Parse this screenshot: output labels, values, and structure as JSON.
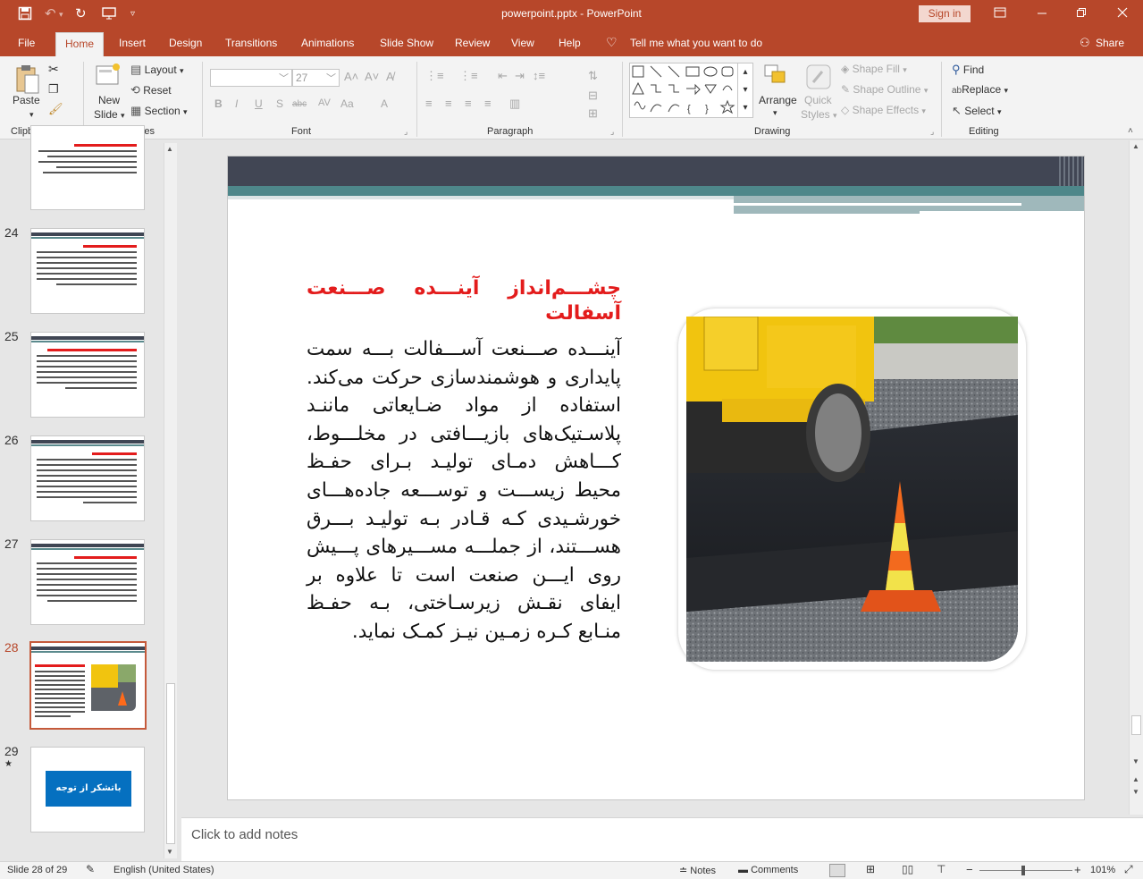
{
  "titlebar": {
    "title": "powerpoint.pptx  -  PowerPoint",
    "signin": "Sign in"
  },
  "tabs": [
    "File",
    "Home",
    "Insert",
    "Design",
    "Transitions",
    "Animations",
    "Slide Show",
    "Review",
    "View",
    "Help"
  ],
  "tell_me": "Tell me what you want to do",
  "share": "Share",
  "ribbon": {
    "clipboard": {
      "label": "Clipboard",
      "paste": "Paste"
    },
    "slides": {
      "label": "Slides",
      "new_slide_1": "New",
      "new_slide_2": "Slide",
      "layout": "Layout",
      "reset": "Reset",
      "section": "Section"
    },
    "font": {
      "label": "Font",
      "size": "27"
    },
    "paragraph": {
      "label": "Paragraph"
    },
    "drawing": {
      "label": "Drawing",
      "arrange": "Arrange",
      "quick_styles_1": "Quick",
      "quick_styles_2": "Styles",
      "shape_fill": "Shape Fill",
      "shape_outline": "Shape Outline",
      "shape_effects": "Shape Effects"
    },
    "editing": {
      "label": "Editing",
      "find": "Find",
      "replace": "Replace",
      "select": "Select"
    }
  },
  "thumbnails": [
    {
      "number": "24"
    },
    {
      "number": "25"
    },
    {
      "number": "26"
    },
    {
      "number": "27"
    },
    {
      "number": "28",
      "selected": true
    },
    {
      "number": "29",
      "text": "باتشکر از توجه شما"
    }
  ],
  "slide": {
    "title": "چشـــم‌انداز آینـــده صـــنعت آسفالت",
    "body": "آینـــده صـــنعت آســـفالت بـــه سمت پایداری و هوشمندسازی حرکت می‌کند. استفاده از مواد ضـایعاتی ماننـد پلاسـتیک‌های بازیـــافتی در مخلـــوط، کـــاهش دمـای تولیـد بـرای حفـظ محیط زیســـت و توســـعه جاده‌هـــای خورشـیدی کـه قـادر بـه تولیـد بـــرق هســـتند، از جملـــه مســـیرهای پـــیش روی ایـــن صنعت است تا علاوه بر ایفای نقـش زیرسـاختی، بـه حفـظ منـابع کـره زمـین نیـز کمـک نماید."
  },
  "notes_placeholder": "Click to add notes",
  "status": {
    "slide_info": "Slide 28 of 29",
    "language": "English (United States)",
    "notes": "Notes",
    "comments": "Comments",
    "zoom": "101%"
  },
  "colors": {
    "accent": "#b7472a",
    "title_red": "#e31c1c",
    "header_dark": "#414654",
    "header_teal": "#4e878a"
  }
}
